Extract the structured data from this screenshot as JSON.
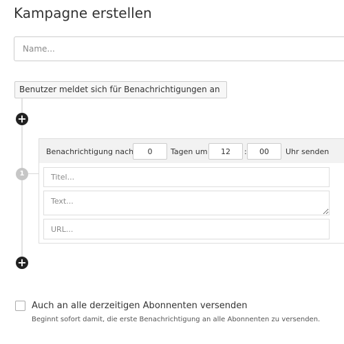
{
  "page": {
    "title": "Kampagne erstellen"
  },
  "campaign": {
    "name_placeholder": "Name..."
  },
  "trigger": {
    "label": "Benutzer meldet sich für Benachrichtigungen an"
  },
  "steps": [
    {
      "number": "1",
      "schedule": {
        "prefix_label": "Benachrichtigung nach",
        "days_value": "0",
        "days_label": "Tagen um",
        "hour_value": "12",
        "time_separator": ":",
        "minute_value": "00",
        "suffix_label": "Uhr senden"
      },
      "title_placeholder": "Titel...",
      "text_placeholder": "Text...",
      "url_placeholder": "URL..."
    }
  ],
  "icons": {
    "add_step_top": "plus-circle-icon",
    "add_step_bottom": "plus-circle-icon",
    "plus_glyph": "+"
  },
  "subscribers_option": {
    "checked": false,
    "label": "Auch an alle derzeitigen Abonnenten versenden",
    "help_text": "Beginnt sofort damit, die erste Benachrichtigung an alle Abonnenten zu versenden."
  },
  "colors": {
    "text": "#333333",
    "border": "#cccccc",
    "card_header_bg": "#f2f2f2",
    "icon_dark": "#222222",
    "step_badge": "#c6c6c6"
  }
}
